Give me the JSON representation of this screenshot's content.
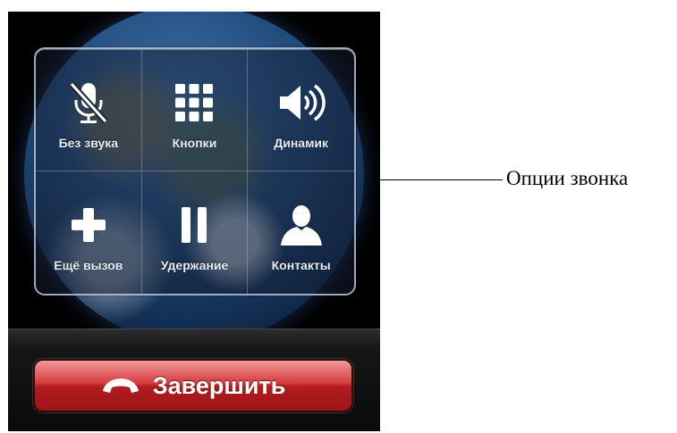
{
  "call_options": {
    "mute": {
      "label": "Без звука",
      "icon": "mic-off-icon"
    },
    "keypad": {
      "label": "Кнопки",
      "icon": "keypad-icon"
    },
    "speaker": {
      "label": "Динамик",
      "icon": "speaker-icon"
    },
    "add_call": {
      "label": "Ещё вызов",
      "icon": "plus-icon"
    },
    "hold": {
      "label": "Удержание",
      "icon": "pause-icon"
    },
    "contacts": {
      "label": "Контакты",
      "icon": "contact-icon"
    }
  },
  "end_call": {
    "label": "Завершить",
    "icon": "phone-hangup-icon",
    "color": "#c22224"
  },
  "annotation": {
    "text": "Опции звонка"
  }
}
